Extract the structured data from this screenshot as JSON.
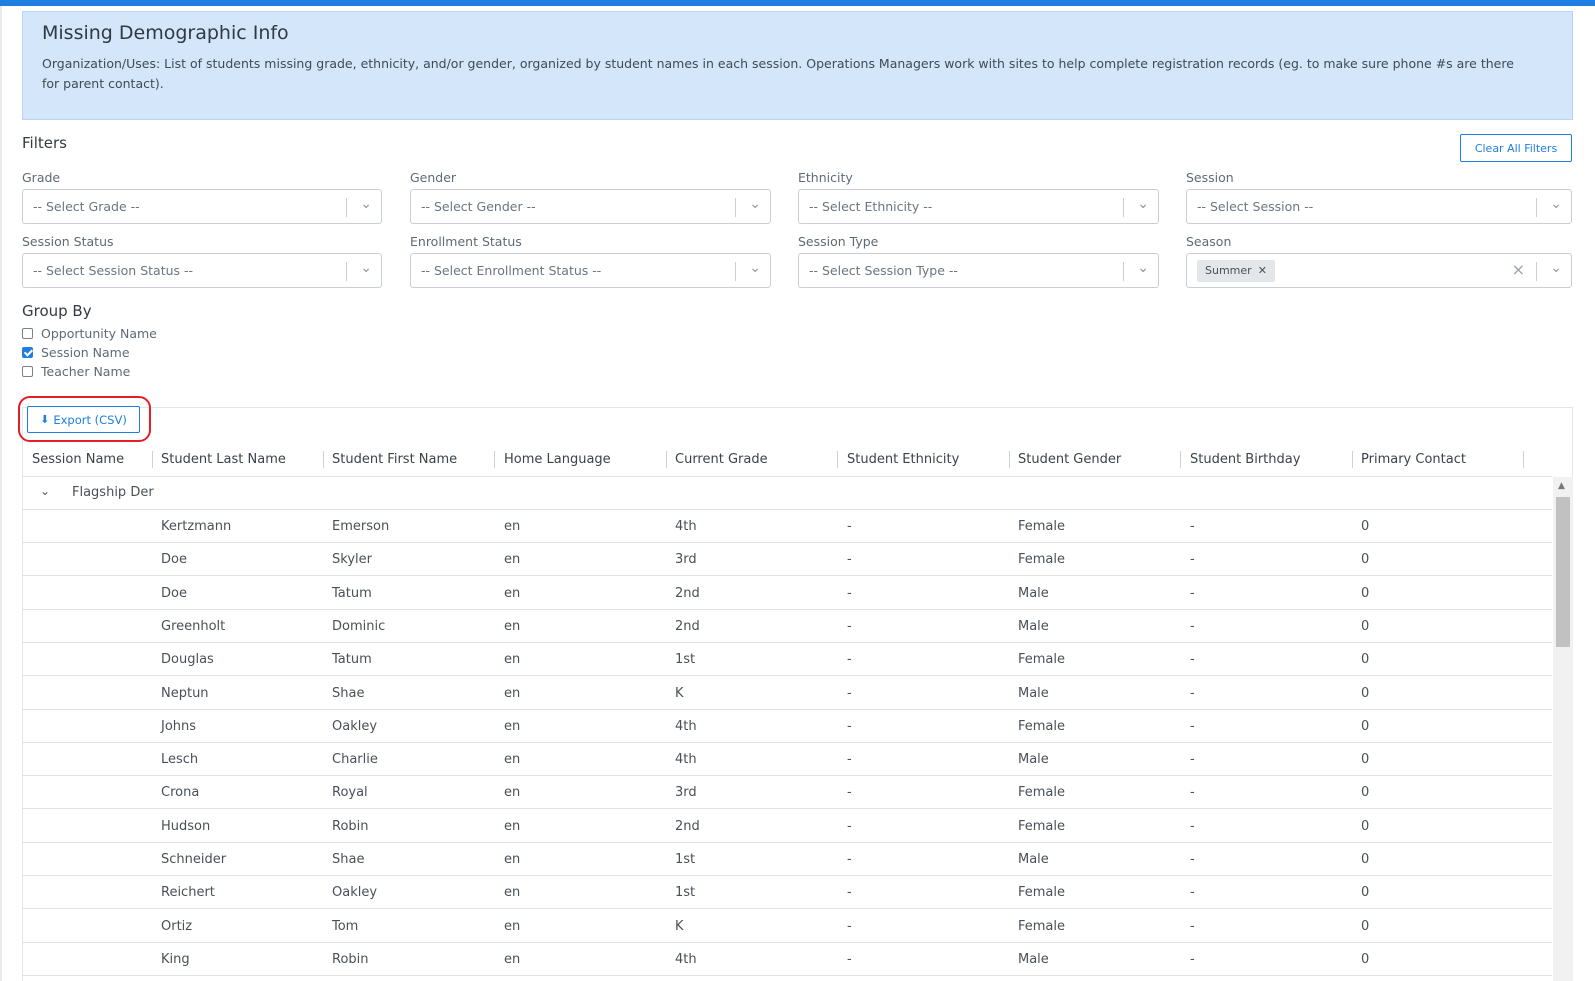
{
  "banner": {
    "title": "Missing Demographic Info",
    "description": "Organization/Uses: List of students missing grade, ethnicity, and/or gender, organized by student names in each session. Operations Managers work with sites to help complete registration records (eg. to make sure phone #s are there for parent contact)."
  },
  "filters": {
    "title": "Filters",
    "clear_label": "Clear All Filters",
    "grade": {
      "label": "Grade",
      "placeholder": "-- Select Grade --"
    },
    "gender": {
      "label": "Gender",
      "placeholder": "-- Select Gender --"
    },
    "ethnicity": {
      "label": "Ethnicity",
      "placeholder": "-- Select Ethnicity --"
    },
    "session": {
      "label": "Session",
      "placeholder": "-- Select Session --"
    },
    "session_status": {
      "label": "Session Status",
      "placeholder": "-- Select Session Status --"
    },
    "enrollment_status": {
      "label": "Enrollment Status",
      "placeholder": "-- Select Enrollment Status --"
    },
    "session_type": {
      "label": "Session Type",
      "placeholder": "-- Select Session Type --"
    },
    "season": {
      "label": "Season",
      "selected": "Summer"
    }
  },
  "group_by": {
    "title": "Group By",
    "options": [
      {
        "label": "Opportunity Name",
        "checked": false
      },
      {
        "label": "Session Name",
        "checked": true
      },
      {
        "label": "Teacher Name",
        "checked": false
      }
    ]
  },
  "export_label": "Export (CSV)",
  "table": {
    "columns": [
      "Session Name",
      "Student Last Name",
      "Student First Name",
      "Home Language",
      "Current Grade",
      "Student Ethnicity",
      "Student Gender",
      "Student Birthday",
      "Primary Contact"
    ],
    "group_name": "Flagship Der",
    "rows": [
      [
        "Kertzmann",
        "Emerson",
        "en",
        "4th",
        "-",
        "Female",
        "-",
        "0"
      ],
      [
        "Doe",
        "Skyler",
        "en",
        "3rd",
        "-",
        "Female",
        "-",
        "0"
      ],
      [
        "Doe",
        "Tatum",
        "en",
        "2nd",
        "-",
        "Male",
        "-",
        "0"
      ],
      [
        "Greenholt",
        "Dominic",
        "en",
        "2nd",
        "-",
        "Male",
        "-",
        "0"
      ],
      [
        "Douglas",
        "Tatum",
        "en",
        "1st",
        "-",
        "Female",
        "-",
        "0"
      ],
      [
        "Neptun",
        "Shae",
        "en",
        "K",
        "-",
        "Male",
        "-",
        "0"
      ],
      [
        "Johns",
        "Oakley",
        "en",
        "4th",
        "-",
        "Female",
        "-",
        "0"
      ],
      [
        "Lesch",
        "Charlie",
        "en",
        "4th",
        "-",
        "Male",
        "-",
        "0"
      ],
      [
        "Crona",
        "Royal",
        "en",
        "3rd",
        "-",
        "Female",
        "-",
        "0"
      ],
      [
        "Hudson",
        "Robin",
        "en",
        "2nd",
        "-",
        "Female",
        "-",
        "0"
      ],
      [
        "Schneider",
        "Shae",
        "en",
        "1st",
        "-",
        "Male",
        "-",
        "0"
      ],
      [
        "Reichert",
        "Oakley",
        "en",
        "1st",
        "-",
        "Female",
        "-",
        "0"
      ],
      [
        "Ortiz",
        "Tom",
        "en",
        "K",
        "-",
        "Female",
        "-",
        "0"
      ],
      [
        "King",
        "Robin",
        "en",
        "4th",
        "-",
        "Male",
        "-",
        "0"
      ]
    ]
  },
  "colors": {
    "accent": "#1f7ee0",
    "banner_bg": "#d3e6fa",
    "highlight": "#e11f26"
  }
}
